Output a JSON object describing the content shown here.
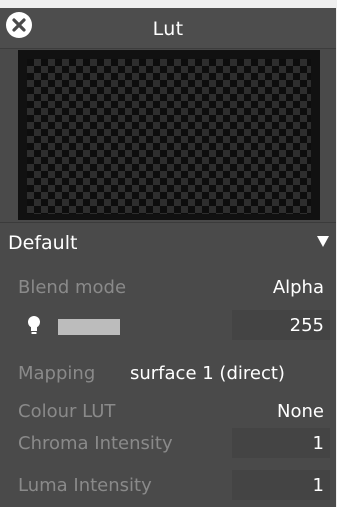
{
  "window": {
    "title": "Lut"
  },
  "icons": {
    "close": "close-circle-icon",
    "dropdown": "triangle-down-icon",
    "light": "lightbulb-icon"
  },
  "colors": {
    "panel_bg": "#4a4a4a",
    "swatch": "#bcbcbc"
  },
  "preset": {
    "label": "Default"
  },
  "properties": {
    "blend_mode": {
      "label": "Blend mode",
      "value": "Alpha"
    },
    "opacity": {
      "value": "255"
    },
    "mapping": {
      "label": "Mapping",
      "value": "surface 1 (direct)"
    },
    "colour_lut": {
      "label": "Colour LUT",
      "value": "None"
    },
    "chroma_intensity": {
      "label": "Chroma Intensity",
      "value": "1"
    },
    "luma_intensity": {
      "label": "Luma Intensity",
      "value": "1"
    }
  }
}
